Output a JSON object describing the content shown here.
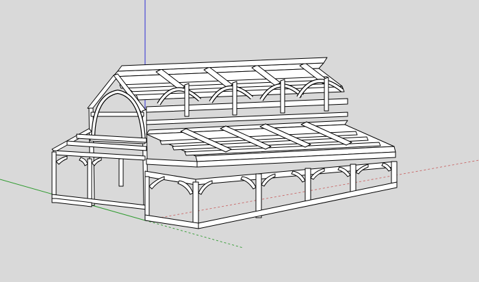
{
  "viewport": {
    "background": "#d9d9d9",
    "member_fill": "#ffffff",
    "member_stroke": "#000000",
    "axes": {
      "green": "#2e9a2e",
      "red": "#c86464",
      "blue": "#3b3bd6"
    },
    "model": {
      "ridge_modules": 4,
      "side_aisle_modules": 5,
      "arched_braces": true
    }
  }
}
